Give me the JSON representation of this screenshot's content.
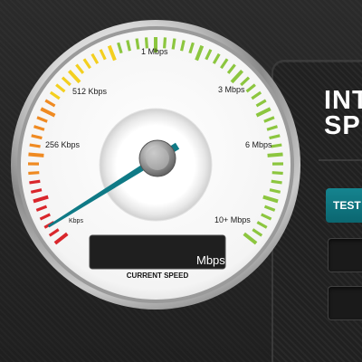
{
  "header": {
    "title_line1": "INT",
    "title_line2": "SP"
  },
  "controls": {
    "test_label": "TEST"
  },
  "gauge": {
    "scale_labels": [
      {
        "text": "Kbps",
        "value_text": ""
      },
      {
        "text": "256 Kbps"
      },
      {
        "text": "512 Kbps"
      },
      {
        "text": "1 Mbps"
      },
      {
        "text": "3 Mbps"
      },
      {
        "text": "6 Mbps"
      },
      {
        "text": "10+ Mbps"
      }
    ],
    "readout_value": "",
    "readout_unit": "Mbps",
    "caption": "CURRENT SPEED",
    "needle_level": 0,
    "colors": {
      "red": "#d9262c",
      "orange": "#ef8a22",
      "yellow": "#f3cf1f",
      "green": "#8cc63f",
      "needle": "#0f7a86",
      "readout_bg": "#1f1f1f"
    }
  }
}
